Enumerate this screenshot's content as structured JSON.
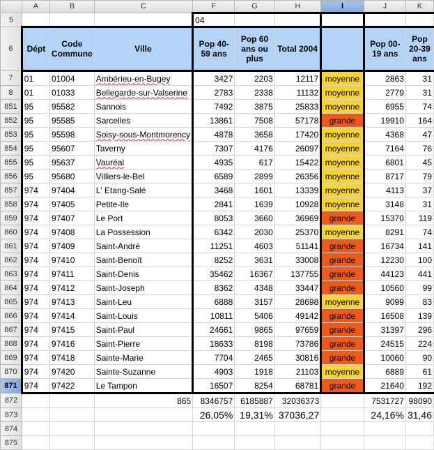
{
  "columns": [
    "A",
    "B",
    "C",
    "F",
    "G",
    "H",
    "I",
    "J",
    "K"
  ],
  "selected_column": "I",
  "selected_row": "871",
  "row5": {
    "number": "5",
    "f_value": "04"
  },
  "header": {
    "row_number": "6",
    "labels": [
      "Dépt",
      "Code Commune",
      "Ville",
      "Pop 40-59 ans",
      "Pop 60 ans ou plus",
      "Total 2004",
      "",
      "Pop 00-19 ans",
      "Pop 20-39 ans"
    ]
  },
  "rows": [
    {
      "row": "7",
      "dept": "01",
      "code": "01004",
      "ville": "Ambérieu-en-Bugey",
      "spell": true,
      "pop40": "3427",
      "pop60": "2203",
      "total": "12117",
      "cat": "moyenne",
      "pop00": "2863",
      "pop20": "31"
    },
    {
      "row": "8",
      "dept": "01",
      "code": "01033",
      "ville": "Bellegarde-sur-Valserine",
      "spell": true,
      "pop40": "2783",
      "pop60": "2338",
      "total": "11132",
      "cat": "moyenne",
      "pop00": "2779",
      "pop20": "31"
    },
    {
      "row": "851",
      "dept": "95",
      "code": "95582",
      "ville": "Sannois",
      "spell": false,
      "pop40": "7492",
      "pop60": "3875",
      "total": "25833",
      "cat": "moyenne",
      "pop00": "6955",
      "pop20": "74"
    },
    {
      "row": "852",
      "dept": "95",
      "code": "95585",
      "ville": "Sarcelles",
      "spell": false,
      "pop40": "13861",
      "pop60": "7508",
      "total": "57178",
      "cat": "grande",
      "pop00": "19910",
      "pop20": "164"
    },
    {
      "row": "853",
      "dept": "95",
      "code": "95598",
      "ville": "Soisy-sous-Montmorency",
      "spell": true,
      "pop40": "4878",
      "pop60": "3658",
      "total": "17420",
      "cat": "moyenne",
      "pop00": "4368",
      "pop20": "47"
    },
    {
      "row": "854",
      "dept": "95",
      "code": "95607",
      "ville": "Taverny",
      "spell": false,
      "pop40": "7307",
      "pop60": "4176",
      "total": "26097",
      "cat": "moyenne",
      "pop00": "7164",
      "pop20": "76"
    },
    {
      "row": "855",
      "dept": "95",
      "code": "95637",
      "ville": "Vauréal",
      "spell": true,
      "pop40": "4935",
      "pop60": "617",
      "total": "15422",
      "cat": "moyenne",
      "pop00": "6801",
      "pop20": "45"
    },
    {
      "row": "856",
      "dept": "95",
      "code": "95680",
      "ville": "Villiers-le-Bel",
      "spell": false,
      "pop40": "6589",
      "pop60": "2899",
      "total": "26356",
      "cat": "moyenne",
      "pop00": "8717",
      "pop20": "79"
    },
    {
      "row": "857",
      "dept": "974",
      "code": "97404",
      "ville": "L' Etang-Salé",
      "spell": false,
      "pop40": "3468",
      "pop60": "1601",
      "total": "13339",
      "cat": "moyenne",
      "pop00": "4113",
      "pop20": "37"
    },
    {
      "row": "858",
      "dept": "974",
      "code": "97405",
      "ville": "Petite-Ile",
      "spell": false,
      "pop40": "2841",
      "pop60": "1639",
      "total": "10928",
      "cat": "moyenne",
      "pop00": "3148",
      "pop20": "31"
    },
    {
      "row": "859",
      "dept": "974",
      "code": "97407",
      "ville": "Le Port",
      "spell": false,
      "pop40": "8053",
      "pop60": "3660",
      "total": "36969",
      "cat": "grande",
      "pop00": "15370",
      "pop20": "119"
    },
    {
      "row": "860",
      "dept": "974",
      "code": "97408",
      "ville": "La Possession",
      "spell": false,
      "pop40": "6342",
      "pop60": "2030",
      "total": "25370",
      "cat": "moyenne",
      "pop00": "8291",
      "pop20": "74"
    },
    {
      "row": "861",
      "dept": "974",
      "code": "97409",
      "ville": "Saint-André",
      "spell": false,
      "pop40": "11251",
      "pop60": "4603",
      "total": "51141",
      "cat": "grande",
      "pop00": "16734",
      "pop20": "141"
    },
    {
      "row": "862",
      "dept": "974",
      "code": "97410",
      "ville": "Saint-Benoît",
      "spell": false,
      "pop40": "8252",
      "pop60": "3631",
      "total": "33008",
      "cat": "grande",
      "pop00": "12230",
      "pop20": "100"
    },
    {
      "row": "863",
      "dept": "974",
      "code": "97411",
      "ville": "Saint-Denis",
      "spell": false,
      "pop40": "35462",
      "pop60": "16367",
      "total": "137755",
      "cat": "grande",
      "pop00": "44123",
      "pop20": "441"
    },
    {
      "row": "864",
      "dept": "974",
      "code": "97412",
      "ville": "Saint-Joseph",
      "spell": false,
      "pop40": "8362",
      "pop60": "4348",
      "total": "33447",
      "cat": "grande",
      "pop00": "10560",
      "pop20": "99"
    },
    {
      "row": "865",
      "dept": "974",
      "code": "97413",
      "ville": "Saint-Leu",
      "spell": false,
      "pop40": "6888",
      "pop60": "3157",
      "total": "28698",
      "cat": "moyenne",
      "pop00": "9099",
      "pop20": "83"
    },
    {
      "row": "866",
      "dept": "974",
      "code": "97414",
      "ville": "Saint-Louis",
      "spell": false,
      "pop40": "10811",
      "pop60": "5406",
      "total": "49142",
      "cat": "grande",
      "pop00": "16508",
      "pop20": "139"
    },
    {
      "row": "867",
      "dept": "974",
      "code": "97415",
      "ville": "Saint-Paul",
      "spell": false,
      "pop40": "24661",
      "pop60": "9865",
      "total": "97659",
      "cat": "grande",
      "pop00": "31397",
      "pop20": "296"
    },
    {
      "row": "868",
      "dept": "974",
      "code": "97416",
      "ville": "Saint-Pierre",
      "spell": false,
      "pop40": "18633",
      "pop60": "8198",
      "total": "73786",
      "cat": "grande",
      "pop00": "24515",
      "pop20": "224"
    },
    {
      "row": "869",
      "dept": "974",
      "code": "97418",
      "ville": "Sainte-Marie",
      "spell": false,
      "pop40": "7704",
      "pop60": "2465",
      "total": "30816",
      "cat": "grande",
      "pop00": "10060",
      "pop20": "90"
    },
    {
      "row": "870",
      "dept": "974",
      "code": "97420",
      "ville": "Sainte-Suzanne",
      "spell": false,
      "pop40": "4903",
      "pop60": "1918",
      "total": "21103",
      "cat": "moyenne",
      "pop00": "6889",
      "pop20": "61"
    },
    {
      "row": "871",
      "dept": "974",
      "code": "97422",
      "ville": "Le Tampon",
      "spell": false,
      "pop40": "16507",
      "pop60": "8254",
      "total": "68781",
      "cat": "grande",
      "pop00": "21640",
      "pop20": "192"
    }
  ],
  "row872": {
    "row": "872",
    "count": "865",
    "pop40": "8346757",
    "pop60": "6185887",
    "total": "32036373",
    "pop00": "7531727",
    "pop20": "98090"
  },
  "row873": {
    "row": "873",
    "pop40": "26,05%",
    "pop60": "19,31%",
    "total": "37036,27",
    "pop00": "24,16%",
    "pop20": "31,46"
  },
  "empty_rows": [
    "874",
    "875"
  ]
}
